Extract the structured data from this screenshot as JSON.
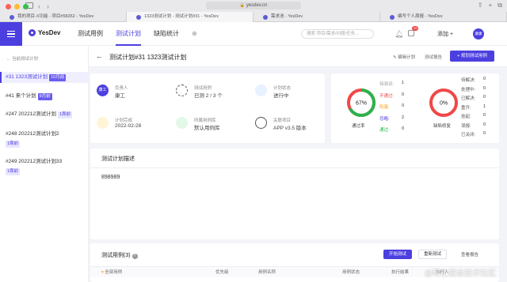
{
  "browser": {
    "url": "yesdev.cn",
    "tabs": [
      {
        "title": "我的项目-X功能 - 项目#58262 - YesDev"
      },
      {
        "title": "1323测试计划 - 测试计划#31 - YesDev"
      },
      {
        "title": "需求池 - YesDev"
      },
      {
        "title": "编写个人周报 - YesDev"
      }
    ]
  },
  "app": {
    "logo": "YesDev",
    "nav": [
      {
        "label": "测试用例"
      },
      {
        "label": "测试计划"
      },
      {
        "label": "缺陷统计"
      }
    ],
    "search_placeholder": "搜索 项目/需求/问题/任务...",
    "notif_badge": "39",
    "add_label": "添加",
    "avatar_text": "康康"
  },
  "sidebar": {
    "back_label": "当前测试计划",
    "items": [
      {
        "label": "#31 1323测试计划",
        "tag": "10月前"
      },
      {
        "label": "#41 来个计划",
        "tag": "9月前"
      },
      {
        "label": "#247 202212测试计划",
        "tag": "1周前"
      },
      {
        "label": "#248 202212测试计划2",
        "tag": "1周前"
      },
      {
        "label": "#249 202212测试计划33",
        "tag": "1周前"
      }
    ]
  },
  "title_bar": {
    "title": "测试计划#31 1323测试计划",
    "edit_label": "编辑计划",
    "report_label": "测试报告",
    "primary_label": "+ 规划测试用例"
  },
  "info": {
    "owner": {
      "label": "负责人",
      "value": "康工",
      "avatar": "康工"
    },
    "cases": {
      "label": "测试用例",
      "value": "已测 2 / 3 个"
    },
    "status": {
      "label": "计划状态",
      "value": "进行中"
    },
    "done": {
      "label": "计划完成",
      "value": "2022-02-28"
    },
    "lib": {
      "label": "所属用例库",
      "value": "默认用例库"
    },
    "project": {
      "label": "关联项目",
      "value": "APP v3.5 版本"
    }
  },
  "pass_stats": {
    "percent_text": "67%",
    "percent": 67,
    "caption": "通过率",
    "items": [
      {
        "label": "待测试:",
        "value": "1",
        "color": "#999999"
      },
      {
        "label": "不通过:",
        "value": "0",
        "color": "#f04848"
      },
      {
        "label": "阻塞:",
        "value": "0",
        "color": "#f5a623"
      },
      {
        "label": "忽略:",
        "value": "2",
        "color": "#4c3fe0"
      },
      {
        "label": "通过:",
        "value": "0",
        "color": "#2bb24c"
      }
    ]
  },
  "bug_stats": {
    "percent_text": "0%",
    "percent": 0,
    "caption": "缺陷修复",
    "items": [
      {
        "label": "待解决:",
        "value": "0"
      },
      {
        "label": "处理中:",
        "value": "0"
      },
      {
        "label": "已解决:",
        "value": "0"
      },
      {
        "label": "重开:",
        "value": "1"
      },
      {
        "label": "挂起:",
        "value": "0"
      },
      {
        "label": "误报:",
        "value": "0"
      },
      {
        "label": "已关闭:",
        "value": "0"
      }
    ]
  },
  "description": {
    "title": "测试计划描述",
    "text": "898989"
  },
  "cases": {
    "title": "测试用例(3)",
    "run_label": "开始测试",
    "reset_label": "重新测试",
    "report_label": "查看报告",
    "columns": [
      "全部用例",
      "优先级",
      "用例名称",
      "用例状态",
      "执行结果",
      "执行人"
    ]
  },
  "watermark": "@稀土掘金技术社区",
  "colors": {
    "accent": "#4c3fe0",
    "pass": "#2bb24c",
    "fail": "#f04848"
  }
}
